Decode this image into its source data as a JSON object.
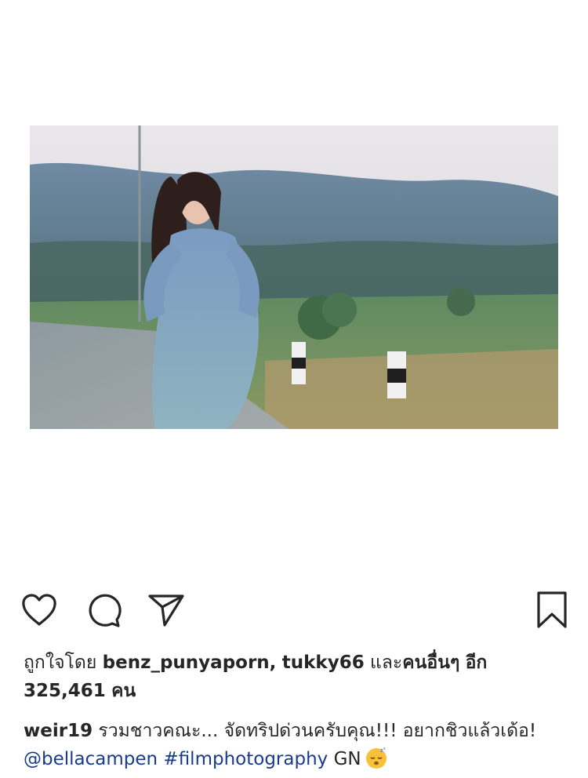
{
  "post": {
    "image_alt": "woman in blue gingham dress walking on road with green hills"
  },
  "actions": {
    "like_icon": "heart-icon",
    "comment_icon": "comment-icon",
    "share_icon": "paper-plane-icon",
    "save_icon": "bookmark-icon"
  },
  "likes": {
    "prefix": "ถูกใจโดย",
    "user1": "benz_punyaporn",
    "sep": ",",
    "user2": "tukky66",
    "and": "และ",
    "others": "คนอื่นๆ",
    "more": "อีก",
    "count": "325,461",
    "unit": "คน"
  },
  "caption": {
    "username": "weir19",
    "text": "รวมชาวคณะ... จัดทริปด่วนครับคุณ!!! อยากชิวแล้วเด้อ!",
    "mention": "@bellacampen",
    "hashtag": "#filmphotography",
    "suffix": "GN",
    "emoji": "sleeping-face-emoji"
  }
}
